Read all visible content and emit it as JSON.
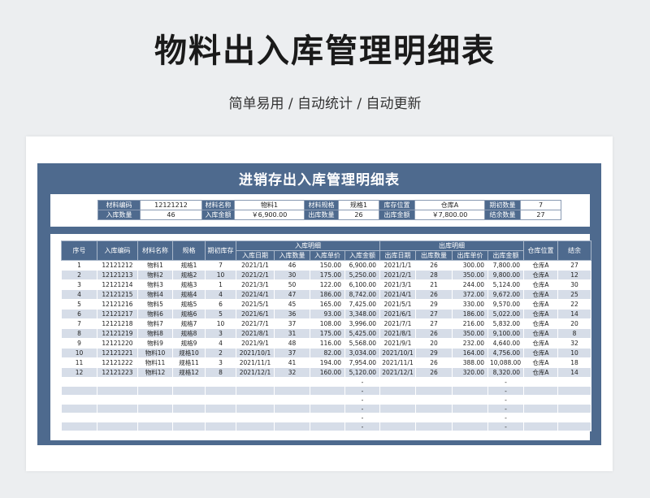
{
  "header": {
    "title": "物料出入库管理明细表",
    "subtitle": "简单易用 / 自动统计 / 自动更新"
  },
  "sheet": {
    "title": "进销存出入库管理明细表",
    "info": {
      "row1": [
        {
          "label": "材料编码",
          "value": "12121212"
        },
        {
          "label": "材料名称",
          "value": "物料1"
        },
        {
          "label": "材料规格",
          "value": "规格1"
        },
        {
          "label": "库存位置",
          "value": "仓库A"
        },
        {
          "label": "期初数量",
          "value": "7"
        }
      ],
      "row2": [
        {
          "label": "入库数量",
          "value": "46"
        },
        {
          "label": "入库金额",
          "value": "￥6,900.00"
        },
        {
          "label": "出库数量",
          "value": "26"
        },
        {
          "label": "出库金额",
          "value": "￥7,800.00"
        },
        {
          "label": "结余数量",
          "value": "27"
        }
      ]
    },
    "table": {
      "group_in": "入库明细",
      "group_out": "出库明细",
      "headers": {
        "seq": "序号",
        "code": "入库编码",
        "name": "材料名称",
        "spec": "规格",
        "opening": "期初库存",
        "in_date": "入库日期",
        "in_qty": "入库数量",
        "in_price": "入库单价",
        "in_amount": "入库金额",
        "out_date": "出库日期",
        "out_qty": "出库数量",
        "out_price": "出库单价",
        "out_amount": "出库金额",
        "location": "仓库位置",
        "balance": "结余"
      },
      "rows": [
        [
          "1",
          "12121212",
          "物料1",
          "规格1",
          "7",
          "2021/1/1",
          "46",
          "150.00",
          "6,900.00",
          "2021/1/1",
          "26",
          "300.00",
          "7,800.00",
          "仓库A",
          "27"
        ],
        [
          "2",
          "12121213",
          "物料2",
          "规格2",
          "10",
          "2021/2/1",
          "30",
          "175.00",
          "5,250.00",
          "2021/2/1",
          "28",
          "350.00",
          "9,800.00",
          "仓库A",
          "12"
        ],
        [
          "3",
          "12121214",
          "物料3",
          "规格3",
          "1",
          "2021/3/1",
          "50",
          "122.00",
          "6,100.00",
          "2021/3/1",
          "21",
          "244.00",
          "5,124.00",
          "仓库A",
          "30"
        ],
        [
          "4",
          "12121215",
          "物料4",
          "规格4",
          "4",
          "2021/4/1",
          "47",
          "186.00",
          "8,742.00",
          "2021/4/1",
          "26",
          "372.00",
          "9,672.00",
          "仓库A",
          "25"
        ],
        [
          "5",
          "12121216",
          "物料5",
          "规格5",
          "6",
          "2021/5/1",
          "45",
          "165.00",
          "7,425.00",
          "2021/5/1",
          "29",
          "330.00",
          "9,570.00",
          "仓库A",
          "22"
        ],
        [
          "6",
          "12121217",
          "物料6",
          "规格6",
          "5",
          "2021/6/1",
          "36",
          "93.00",
          "3,348.00",
          "2021/6/1",
          "27",
          "186.00",
          "5,022.00",
          "仓库A",
          "14"
        ],
        [
          "7",
          "12121218",
          "物料7",
          "规格7",
          "10",
          "2021/7/1",
          "37",
          "108.00",
          "3,996.00",
          "2021/7/1",
          "27",
          "216.00",
          "5,832.00",
          "仓库A",
          "20"
        ],
        [
          "8",
          "12121219",
          "物料8",
          "规格8",
          "3",
          "2021/8/1",
          "31",
          "175.00",
          "5,425.00",
          "2021/8/1",
          "26",
          "350.00",
          "9,100.00",
          "仓库A",
          "8"
        ],
        [
          "9",
          "12121220",
          "物料9",
          "规格9",
          "4",
          "2021/9/1",
          "48",
          "116.00",
          "5,568.00",
          "2021/9/1",
          "20",
          "232.00",
          "4,640.00",
          "仓库A",
          "32"
        ],
        [
          "10",
          "12121221",
          "物料10",
          "规格10",
          "2",
          "2021/10/1",
          "37",
          "82.00",
          "3,034.00",
          "2021/10/1",
          "29",
          "164.00",
          "4,756.00",
          "仓库A",
          "10"
        ],
        [
          "11",
          "12121222",
          "物料11",
          "规格11",
          "3",
          "2021/11/1",
          "41",
          "194.00",
          "7,954.00",
          "2021/11/1",
          "26",
          "388.00",
          "10,088.00",
          "仓库A",
          "18"
        ],
        [
          "12",
          "12121223",
          "物料12",
          "规格12",
          "8",
          "2021/12/1",
          "32",
          "160.00",
          "5,120.00",
          "2021/12/1",
          "26",
          "320.00",
          "8,320.00",
          "仓库A",
          "14"
        ],
        [
          "",
          "",
          "",
          "",
          "",
          "",
          "",
          "",
          "-",
          "",
          "",
          "",
          "-",
          "",
          ""
        ],
        [
          "",
          "",
          "",
          "",
          "",
          "",
          "",
          "",
          "-",
          "",
          "",
          "",
          "-",
          "",
          ""
        ],
        [
          "",
          "",
          "",
          "",
          "",
          "",
          "",
          "",
          "-",
          "",
          "",
          "",
          "-",
          "",
          ""
        ],
        [
          "",
          "",
          "",
          "",
          "",
          "",
          "",
          "",
          "-",
          "",
          "",
          "",
          "-",
          "",
          ""
        ],
        [
          "",
          "",
          "",
          "",
          "",
          "",
          "",
          "",
          "-",
          "",
          "",
          "",
          "-",
          "",
          ""
        ],
        [
          "",
          "",
          "",
          "",
          "",
          "",
          "",
          "",
          "-",
          "",
          "",
          "",
          "-",
          "",
          ""
        ]
      ]
    }
  }
}
